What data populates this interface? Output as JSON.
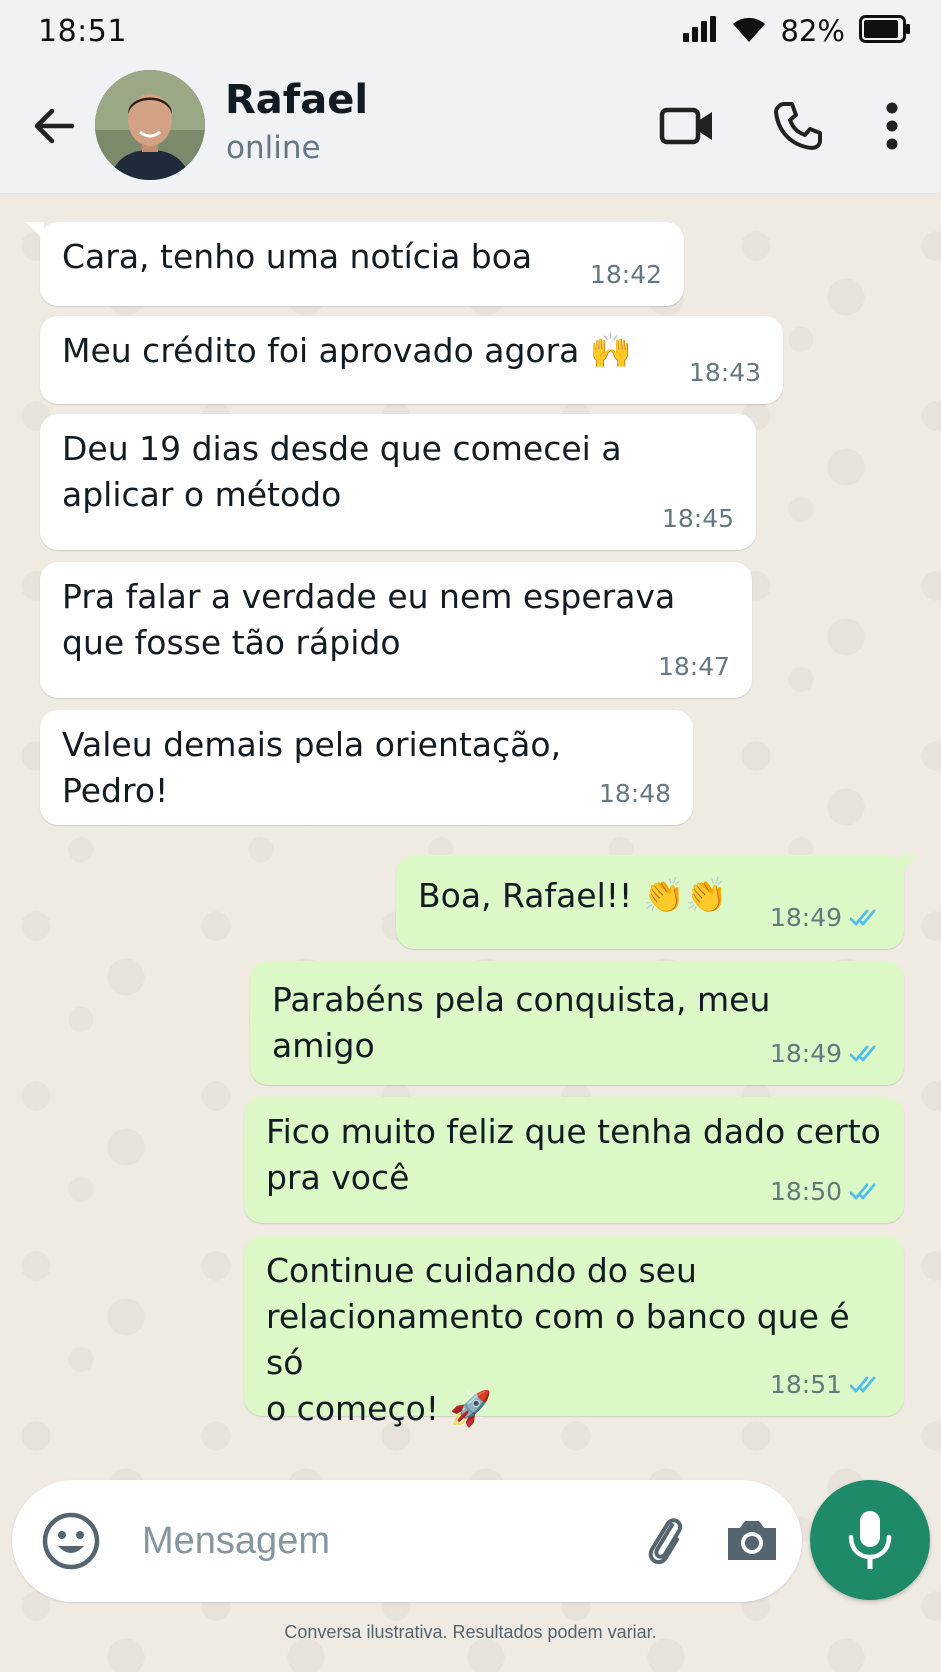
{
  "status_bar": {
    "time": "18:51",
    "battery": "82%",
    "icons": [
      "signal-icon",
      "wifi-icon",
      "battery-icon"
    ]
  },
  "header": {
    "contact_name": "Rafael",
    "contact_status": "online",
    "icons": [
      "back-arrow-icon",
      "video-call-icon",
      "phone-icon",
      "more-vert-icon"
    ]
  },
  "messages": [
    {
      "direction": "in",
      "text": "Cara, tenho uma notícia boa",
      "time": "18:42"
    },
    {
      "direction": "in",
      "text": "Meu crédito foi aprovado agora",
      "emoji": "🙌",
      "time": "18:43"
    },
    {
      "direction": "in",
      "text": "Deu 19 dias desde que comecei a\naplicar o método",
      "time": "18:45"
    },
    {
      "direction": "in",
      "text": "Pra falar a verdade eu nem esperava\nque fosse tão rápido",
      "time": "18:47"
    },
    {
      "direction": "in",
      "text": "Valeu demais pela orientação, Pedro!",
      "time": "18:48"
    },
    {
      "direction": "out",
      "text": "Boa, Rafael!!",
      "emoji": "👏👏",
      "time": "18:49",
      "read": true
    },
    {
      "direction": "out",
      "text": "Parabéns pela conquista, meu amigo",
      "time": "18:49",
      "read": true
    },
    {
      "direction": "out",
      "text": "Fico muito feliz que tenha dado certo\npra você",
      "time": "18:50",
      "read": true
    },
    {
      "direction": "out",
      "text": "Continue cuidando do seu\nrelacionamento com o banco que é só\no começo!",
      "emoji": "🚀",
      "time": "18:51",
      "read": true
    }
  ],
  "input": {
    "placeholder": "Mensagem",
    "icons": [
      "emoji-icon",
      "attach-icon",
      "camera-icon",
      "mic-icon"
    ]
  },
  "disclaimer": "Conversa ilustrativa. Resultados podem variar.",
  "colors": {
    "header_bg": "#f0f2f5",
    "chat_bg": "#efeae2",
    "incoming_bubble": "#ffffff",
    "outgoing_bubble": "#dcf8c6",
    "read_ticks": "#53bdeb",
    "mic_button": "#1e8a6a"
  }
}
